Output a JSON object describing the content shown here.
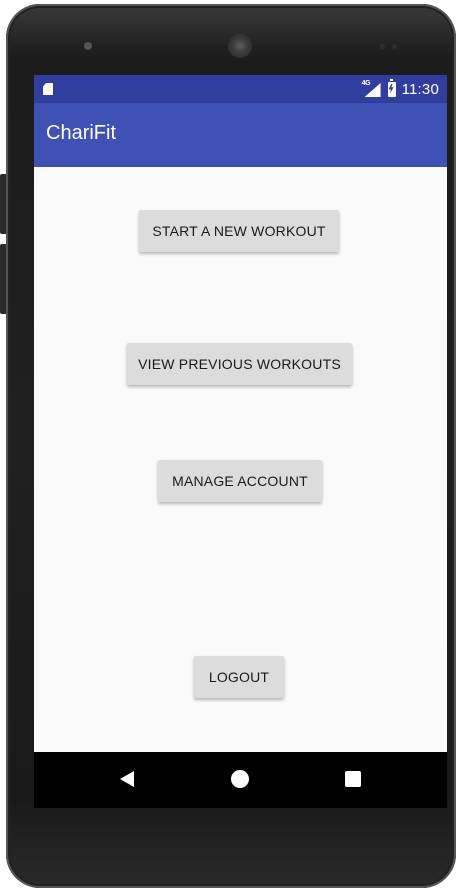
{
  "status_bar": {
    "time": "11:30",
    "network_type": "4G",
    "icons": [
      "sd-card-icon",
      "signal-icon",
      "battery-charging-icon"
    ]
  },
  "app_bar": {
    "title": "ChariFit"
  },
  "main": {
    "buttons": [
      {
        "label": "START A NEW WORKOUT"
      },
      {
        "label": "VIEW PREVIOUS WORKOUTS"
      },
      {
        "label": "MANAGE ACCOUNT"
      },
      {
        "label": "LOGOUT"
      }
    ]
  },
  "nav_bar": {
    "icons": [
      "back-icon",
      "home-icon",
      "recents-icon"
    ]
  },
  "colors": {
    "primary": "#3f51b5",
    "primary_dark": "#303f9f",
    "background": "#fafafa",
    "button": "#dcdcdc"
  }
}
